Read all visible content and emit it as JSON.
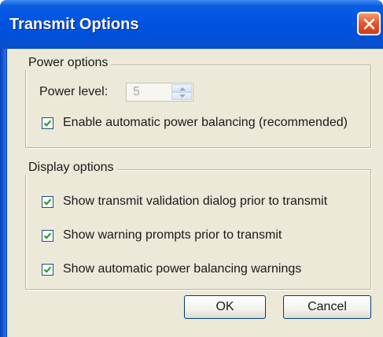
{
  "window": {
    "title": "Transmit Options"
  },
  "power_options": {
    "legend": "Power options",
    "power_level_label": "Power level:",
    "power_level_value": "5",
    "auto_balance_label": "Enable automatic power balancing (recommended)",
    "auto_balance_checked": true
  },
  "display_options": {
    "legend": "Display options",
    "items": [
      {
        "label": "Show transmit validation dialog prior to transmit",
        "checked": true
      },
      {
        "label": "Show warning prompts prior to transmit",
        "checked": true
      },
      {
        "label": "Show automatic power balancing warnings",
        "checked": true
      }
    ]
  },
  "buttons": {
    "ok": "OK",
    "cancel": "Cancel"
  },
  "colors": {
    "title_bar": "#0054e3",
    "dialog_face": "#ece9d8",
    "close_button": "#e4542b"
  }
}
